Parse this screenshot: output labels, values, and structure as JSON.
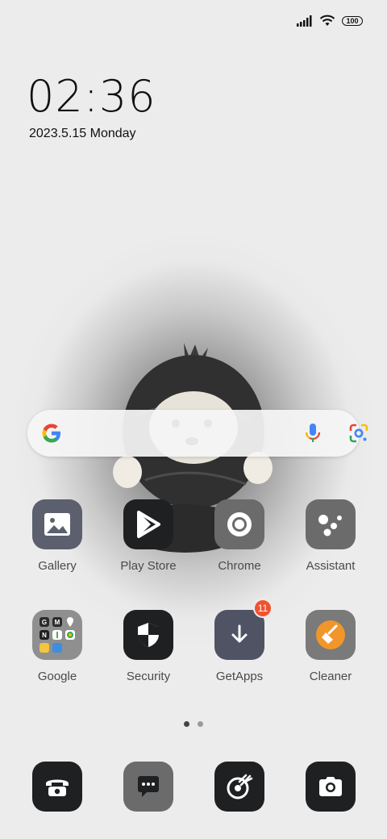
{
  "status_bar": {
    "battery": "100"
  },
  "clock": {
    "time": "02:36",
    "date": "2023.5.15 Monday"
  },
  "apps_row1": [
    {
      "label": "Gallery",
      "icon": "gallery-icon",
      "bg": "#5b5f6e"
    },
    {
      "label": "Play Store",
      "icon": "play-store-icon",
      "bg": "#1f2022"
    },
    {
      "label": "Chrome",
      "icon": "chrome-icon",
      "bg": "#6b6b6b"
    },
    {
      "label": "Assistant",
      "icon": "assistant-icon",
      "bg": "#6b6b6b"
    }
  ],
  "apps_row2": [
    {
      "label": "Google",
      "icon": "google-folder-icon",
      "bg": "#8f8f8f"
    },
    {
      "label": "Security",
      "icon": "security-icon",
      "bg": "#1f2022"
    },
    {
      "label": "GetApps",
      "icon": "getapps-icon",
      "bg": "#4f5363",
      "badge": "11"
    },
    {
      "label": "Cleaner",
      "icon": "cleaner-icon",
      "bg": "#7a7a7a"
    }
  ],
  "dock": [
    {
      "icon": "phone-icon",
      "bg": "#1f2022"
    },
    {
      "icon": "messages-icon",
      "bg": "#6b6b6b"
    },
    {
      "icon": "browser-icon",
      "bg": "#1f2022"
    },
    {
      "icon": "camera-icon",
      "bg": "#1f2022"
    }
  ],
  "page_indicator": {
    "active_color": "#444444",
    "inactive_color": "#9a9a9a"
  },
  "colors": {
    "badge": "#f2522e",
    "cleaner_accent": "#f0962b"
  }
}
